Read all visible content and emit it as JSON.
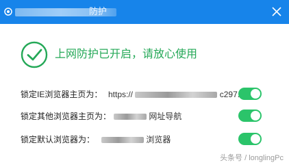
{
  "titlebar": {
    "title_suffix": "防护",
    "close_icon": "close-icon",
    "logo_icon": "shield-logo-icon",
    "color": "#1784ea"
  },
  "status": {
    "icon": "check-circle-icon",
    "message": "上网防护已开启，请放心使用",
    "color": "#24a857"
  },
  "settings": [
    {
      "label": "锁定IE浏览器主页为：",
      "value": "https://",
      "value_tail": "c297...",
      "enabled": true
    },
    {
      "label": "锁定其他浏览器主页为：",
      "value": "网址导航",
      "enabled": true
    },
    {
      "label": "锁定默认浏览器为：",
      "value": "浏览器",
      "enabled": true
    }
  ],
  "toggle_color": "#2bc46a",
  "watermark": "头条号 / longlingPc"
}
